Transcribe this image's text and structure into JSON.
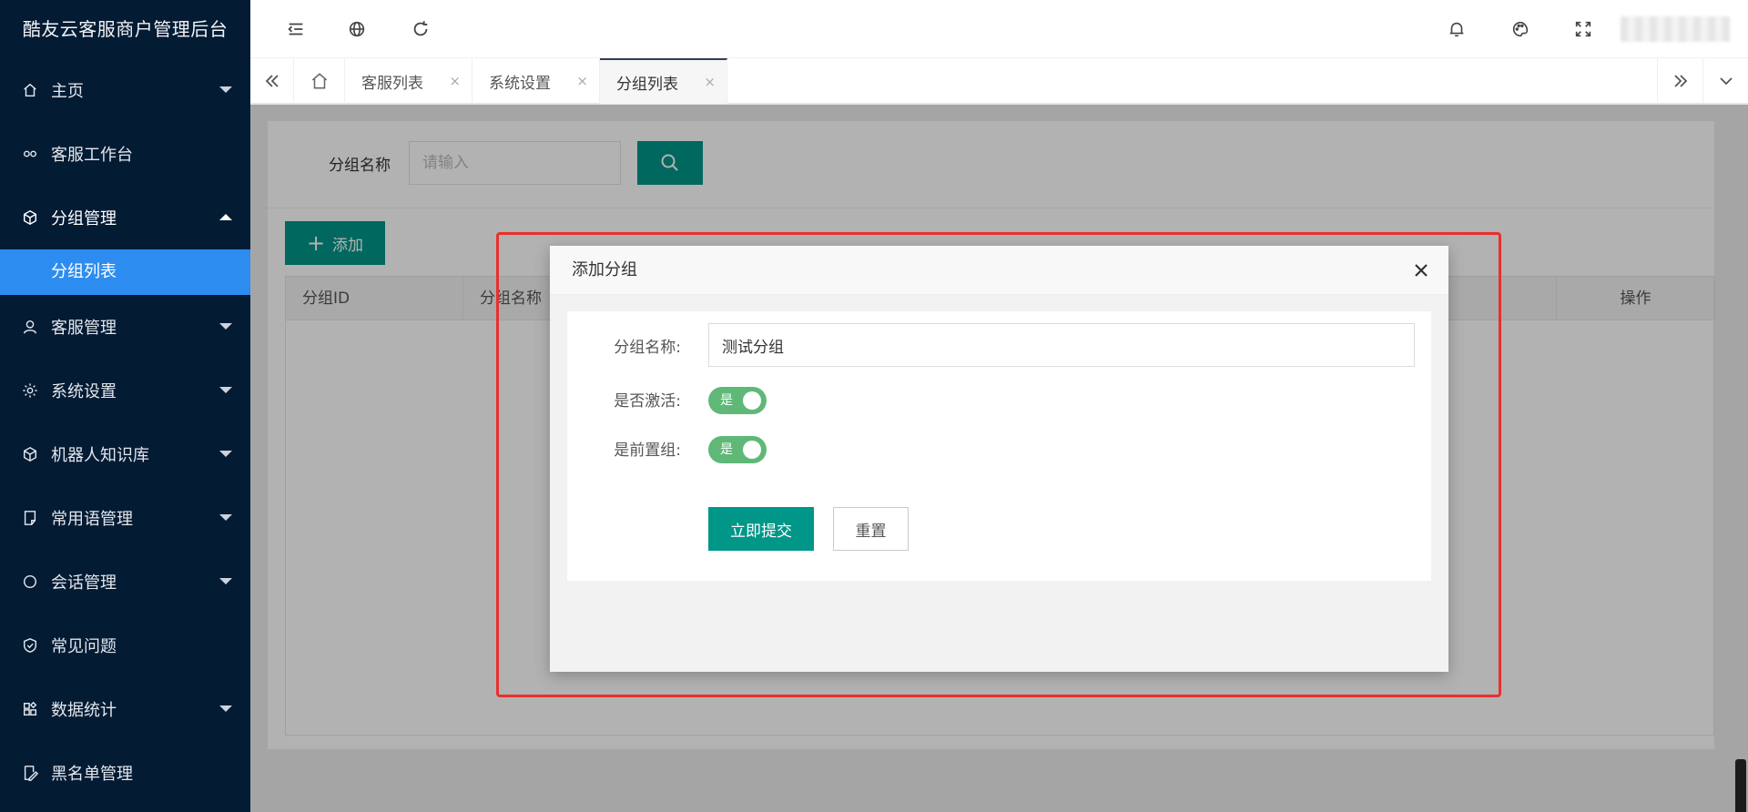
{
  "app": {
    "title": "酷友云客服商户管理后台"
  },
  "sidebar": {
    "items": [
      {
        "label": "主页",
        "icon": "home-icon",
        "has_caret": true
      },
      {
        "label": "客服工作台",
        "icon": "infinity-icon",
        "has_caret": false
      },
      {
        "label": "分组管理",
        "icon": "cube-icon",
        "has_caret": true,
        "open": true
      },
      {
        "label": "客服管理",
        "icon": "user-icon",
        "has_caret": true
      },
      {
        "label": "系统设置",
        "icon": "gear-icon",
        "has_caret": true
      },
      {
        "label": "机器人知识库",
        "icon": "cube-icon",
        "has_caret": true
      },
      {
        "label": "常用语管理",
        "icon": "note-icon",
        "has_caret": true
      },
      {
        "label": "会话管理",
        "icon": "chat-icon",
        "has_caret": true
      },
      {
        "label": "常见问题",
        "icon": "shield-icon",
        "has_caret": false
      },
      {
        "label": "数据统计",
        "icon": "grid-icon",
        "has_caret": true
      },
      {
        "label": "黑名单管理",
        "icon": "edit-icon",
        "has_caret": false
      }
    ],
    "sub_active": "分组列表"
  },
  "tabs": {
    "items": [
      {
        "label": "客服列表"
      },
      {
        "label": "系统设置"
      },
      {
        "label": "分组列表",
        "active": true
      }
    ],
    "close_glyph": "×"
  },
  "search": {
    "label": "分组名称",
    "placeholder": "请输入"
  },
  "toolbar": {
    "add_label": "添加",
    "add_plus": "+"
  },
  "table": {
    "columns": [
      "分组ID",
      "分组名称",
      "操作"
    ]
  },
  "dialog": {
    "title": "添加分组",
    "fields": {
      "name_label": "分组名称:",
      "name_value": "测试分组",
      "active_label": "是否激活:",
      "active_switch_text": "是",
      "front_label": "是前置组:",
      "front_switch_text": "是"
    },
    "submit_label": "立即提交",
    "reset_label": "重置"
  },
  "colors": {
    "sidebar_bg": "#041b34",
    "sidebar_active": "#2d8cf0",
    "primary": "#009688",
    "switch_on": "#5fb878",
    "annotation_red": "#e8302e"
  }
}
